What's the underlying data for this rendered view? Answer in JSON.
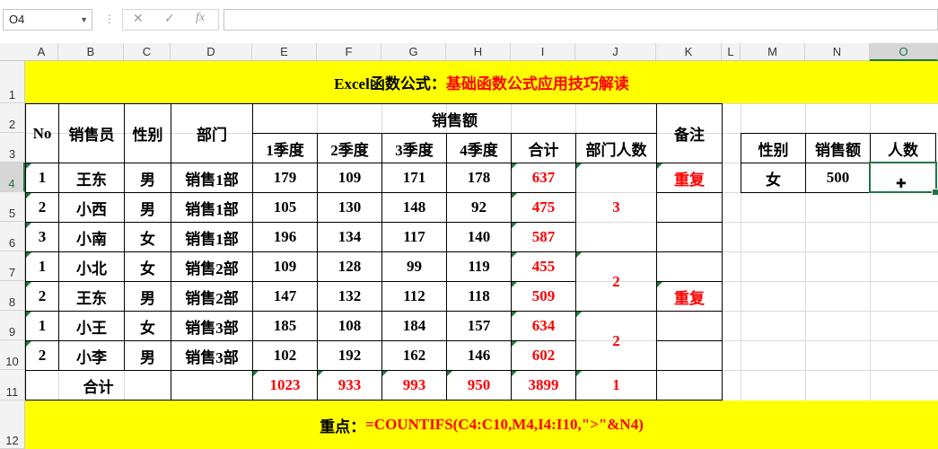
{
  "formula_bar": {
    "name_box": "O4",
    "fx_label": "fx",
    "formula": ""
  },
  "columns": [
    "A",
    "B",
    "C",
    "D",
    "E",
    "F",
    "G",
    "H",
    "I",
    "J",
    "K",
    "L",
    "M",
    "N",
    "O"
  ],
  "rows": [
    "1",
    "2",
    "3",
    "4",
    "5",
    "6",
    "7",
    "8",
    "9",
    "10",
    "11",
    "12"
  ],
  "selected_cell": "O4",
  "title": {
    "prefix": "Excel函数公式：",
    "main": "基础函数公式应用技巧解读"
  },
  "headers": {
    "no": "No",
    "salesperson": "销售员",
    "gender": "性别",
    "dept": "部门",
    "sales": "销售额",
    "remark": "备注",
    "q1": "1季度",
    "q2": "2季度",
    "q3": "3季度",
    "q4": "4季度",
    "total": "合计",
    "dept_count": "部门人数"
  },
  "table_rows": [
    {
      "no": "1",
      "name": "王东",
      "gender": "男",
      "dept": "销售1部",
      "q1": "179",
      "q2": "109",
      "q3": "171",
      "q4": "178",
      "total": "637",
      "remark": "重复"
    },
    {
      "no": "2",
      "name": "小西",
      "gender": "男",
      "dept": "销售1部",
      "q1": "105",
      "q2": "130",
      "q3": "148",
      "q4": "92",
      "total": "475",
      "remark": ""
    },
    {
      "no": "3",
      "name": "小南",
      "gender": "女",
      "dept": "销售1部",
      "q1": "196",
      "q2": "134",
      "q3": "117",
      "q4": "140",
      "total": "587",
      "remark": ""
    },
    {
      "no": "1",
      "name": "小北",
      "gender": "女",
      "dept": "销售2部",
      "q1": "109",
      "q2": "128",
      "q3": "99",
      "q4": "119",
      "total": "455",
      "remark": ""
    },
    {
      "no": "2",
      "name": "王东",
      "gender": "男",
      "dept": "销售2部",
      "q1": "147",
      "q2": "132",
      "q3": "112",
      "q4": "118",
      "total": "509",
      "remark": "重复"
    },
    {
      "no": "1",
      "name": "小王",
      "gender": "女",
      "dept": "销售3部",
      "q1": "185",
      "q2": "108",
      "q3": "184",
      "q4": "157",
      "total": "634",
      "remark": ""
    },
    {
      "no": "2",
      "name": "小李",
      "gender": "男",
      "dept": "销售3部",
      "q1": "102",
      "q2": "192",
      "q3": "162",
      "q4": "146",
      "total": "602",
      "remark": ""
    }
  ],
  "dept_counts": [
    "3",
    "2",
    "2"
  ],
  "totals": {
    "label": "合计",
    "q1": "1023",
    "q2": "933",
    "q3": "993",
    "q4": "950",
    "total": "3899",
    "dept_count": "1"
  },
  "side_table": {
    "headers": [
      "性别",
      "销售额",
      "人数"
    ],
    "values": [
      "女",
      "500",
      ""
    ]
  },
  "note": {
    "prefix": "重点：",
    "formula": "=COUNTIFS(C4:C10,M4,I4:I10,\">\"&N4)"
  },
  "colors": {
    "highlight": "#ffff00",
    "accent_red": "#ff0000",
    "excel_green": "#217346"
  }
}
